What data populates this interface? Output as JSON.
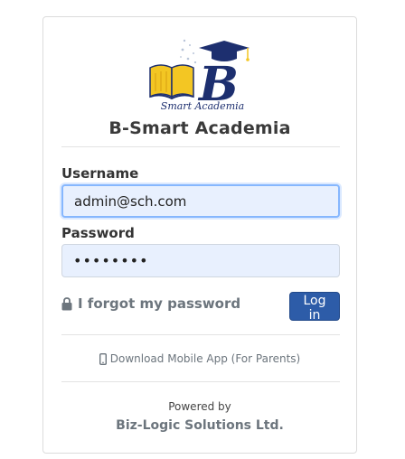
{
  "brand": {
    "logo_text": "Smart Academia",
    "logo_letter": "B",
    "title": "B-Smart Academia",
    "colors": {
      "navy": "#1d2f6f",
      "book_yellow": "#f3c623"
    }
  },
  "form": {
    "username_label": "Username",
    "username_value": "admin@sch.com",
    "password_label": "Password",
    "password_value": "••••••••"
  },
  "links": {
    "forgot_password": "I forgot my password",
    "forgot_icon": "lock-icon",
    "download_app": "Download Mobile App (For Parents)",
    "download_icon": "mobile-phone-icon"
  },
  "buttons": {
    "login_label": "Log in",
    "login_color": "#2d5ca8"
  },
  "footer": {
    "powered_by": "Powered by",
    "company": "Biz-Logic Solutions Ltd."
  }
}
